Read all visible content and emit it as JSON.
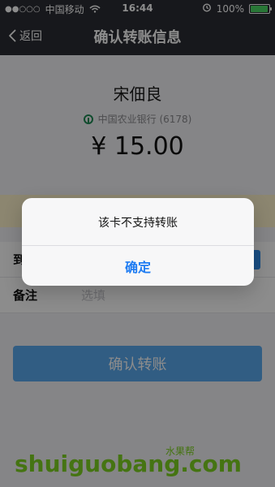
{
  "status_bar": {
    "carrier": "中国移动",
    "signal_dots": "●●○○○",
    "time": "16:44",
    "battery": "100%"
  },
  "nav": {
    "back_label": "返回",
    "title": "确认转账信息"
  },
  "transfer": {
    "payee_name": "宋佃良",
    "bank": "中国农业银行 (6178)",
    "amount": "¥ 15.00"
  },
  "form": {
    "to_label": "到",
    "remark_label": "备注",
    "remark_placeholder": "选填"
  },
  "actions": {
    "confirm_transfer": "确认转账"
  },
  "dialog": {
    "message": "该卡不支持转账",
    "ok": "确定"
  },
  "watermark": {
    "main": "shuiguobang.com",
    "small": "水果帮"
  },
  "colors": {
    "nav_bg": "#2b2d33",
    "primary": "#5aa9ee",
    "dialog_ok": "#1e7cf2",
    "bank_green": "#1e8b54",
    "watermark": "#7ed321"
  }
}
